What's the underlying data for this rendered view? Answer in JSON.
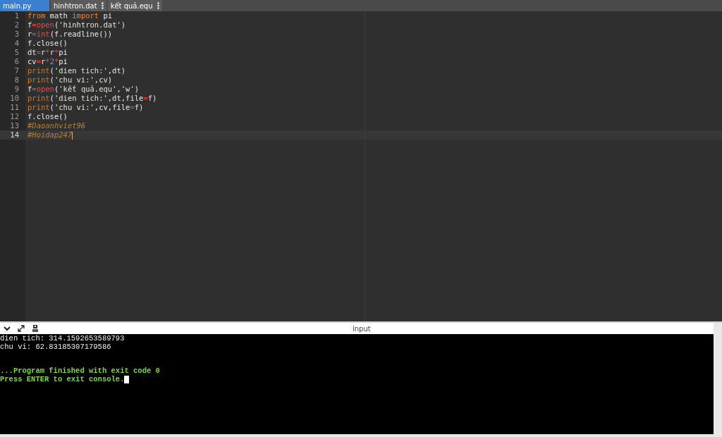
{
  "tabs": [
    {
      "label": "main.py",
      "selected": true,
      "menu": false
    },
    {
      "label": "hinhtron.dat",
      "selected": false,
      "menu": true
    },
    {
      "label": "kết quả.equ",
      "selected": false,
      "menu": true
    }
  ],
  "editor": {
    "lines": [
      {
        "number": "1",
        "active": false,
        "tokens": [
          {
            "kind": "keyword",
            "text": "from"
          },
          {
            "kind": "plain",
            "text": " math "
          },
          {
            "kind": "keyword",
            "text": "import"
          },
          {
            "kind": "plain",
            "text": " pi"
          }
        ]
      },
      {
        "number": "2",
        "active": false,
        "tokens": [
          {
            "kind": "plain",
            "text": "f"
          },
          {
            "kind": "operator",
            "text": "="
          },
          {
            "kind": "builtin",
            "text": "open"
          },
          {
            "kind": "plain",
            "text": "("
          },
          {
            "kind": "string",
            "text": "'hinhtron.dat'"
          },
          {
            "kind": "plain",
            "text": ")"
          }
        ]
      },
      {
        "number": "3",
        "active": false,
        "tokens": [
          {
            "kind": "plain",
            "text": "r"
          },
          {
            "kind": "operator",
            "text": "="
          },
          {
            "kind": "builtin",
            "text": "int"
          },
          {
            "kind": "plain",
            "text": "(f.readline())"
          }
        ]
      },
      {
        "number": "4",
        "active": false,
        "tokens": [
          {
            "kind": "plain",
            "text": "f.close()"
          }
        ]
      },
      {
        "number": "5",
        "active": false,
        "tokens": [
          {
            "kind": "plain",
            "text": "dt"
          },
          {
            "kind": "operator",
            "text": "="
          },
          {
            "kind": "plain",
            "text": "r"
          },
          {
            "kind": "operator",
            "text": "*"
          },
          {
            "kind": "plain",
            "text": "r"
          },
          {
            "kind": "operator",
            "text": "*"
          },
          {
            "kind": "plain",
            "text": "pi"
          }
        ]
      },
      {
        "number": "6",
        "active": false,
        "tokens": [
          {
            "kind": "plain",
            "text": "cv"
          },
          {
            "kind": "operator",
            "text": "="
          },
          {
            "kind": "plain",
            "text": "r"
          },
          {
            "kind": "operator",
            "text": "*"
          },
          {
            "kind": "number",
            "text": "2"
          },
          {
            "kind": "operator",
            "text": "*"
          },
          {
            "kind": "plain",
            "text": "pi"
          }
        ]
      },
      {
        "number": "7",
        "active": false,
        "tokens": [
          {
            "kind": "print",
            "text": "print"
          },
          {
            "kind": "plain",
            "text": "("
          },
          {
            "kind": "string",
            "text": "'dien tich:'"
          },
          {
            "kind": "plain",
            "text": ",dt)"
          }
        ]
      },
      {
        "number": "8",
        "active": false,
        "tokens": [
          {
            "kind": "print",
            "text": "print"
          },
          {
            "kind": "plain",
            "text": "("
          },
          {
            "kind": "string",
            "text": "'chu vi:'"
          },
          {
            "kind": "plain",
            "text": ",cv)"
          }
        ]
      },
      {
        "number": "9",
        "active": false,
        "tokens": [
          {
            "kind": "plain",
            "text": "f"
          },
          {
            "kind": "operator",
            "text": "="
          },
          {
            "kind": "builtin",
            "text": "open"
          },
          {
            "kind": "plain",
            "text": "("
          },
          {
            "kind": "string",
            "text": "'kết quả.equ'"
          },
          {
            "kind": "plain",
            "text": ","
          },
          {
            "kind": "string",
            "text": "'w'"
          },
          {
            "kind": "plain",
            "text": ")"
          }
        ]
      },
      {
        "number": "10",
        "active": false,
        "tokens": [
          {
            "kind": "print",
            "text": "print"
          },
          {
            "kind": "plain",
            "text": "("
          },
          {
            "kind": "string",
            "text": "'dien tich:'"
          },
          {
            "kind": "plain",
            "text": ",dt,file"
          },
          {
            "kind": "operator",
            "text": "="
          },
          {
            "kind": "plain",
            "text": "f)"
          }
        ]
      },
      {
        "number": "11",
        "active": false,
        "tokens": [
          {
            "kind": "print",
            "text": "print"
          },
          {
            "kind": "plain",
            "text": "("
          },
          {
            "kind": "string",
            "text": "'chu vi:'"
          },
          {
            "kind": "plain",
            "text": ",cv,file"
          },
          {
            "kind": "operator",
            "text": "="
          },
          {
            "kind": "plain",
            "text": "f)"
          }
        ]
      },
      {
        "number": "12",
        "active": false,
        "tokens": [
          {
            "kind": "plain",
            "text": "f.close()"
          }
        ]
      },
      {
        "number": "13",
        "active": false,
        "tokens": [
          {
            "kind": "comment",
            "text": "#Daoanhviet96"
          }
        ]
      },
      {
        "number": "14",
        "active": true,
        "tokens": [
          {
            "kind": "comment",
            "text": "#Hoidap247"
          }
        ]
      }
    ]
  },
  "console": {
    "title": "input",
    "lines": [
      {
        "kind": "output",
        "text": "dien tich: 314.1592653589793"
      },
      {
        "kind": "output",
        "text": "chu vi: 62.83185307179586"
      },
      {
        "kind": "blank"
      },
      {
        "kind": "blank"
      },
      {
        "kind": "status",
        "text": "...Program finished with exit code 0"
      },
      {
        "kind": "prompt",
        "text": "Press ENTER to exit console."
      }
    ]
  }
}
